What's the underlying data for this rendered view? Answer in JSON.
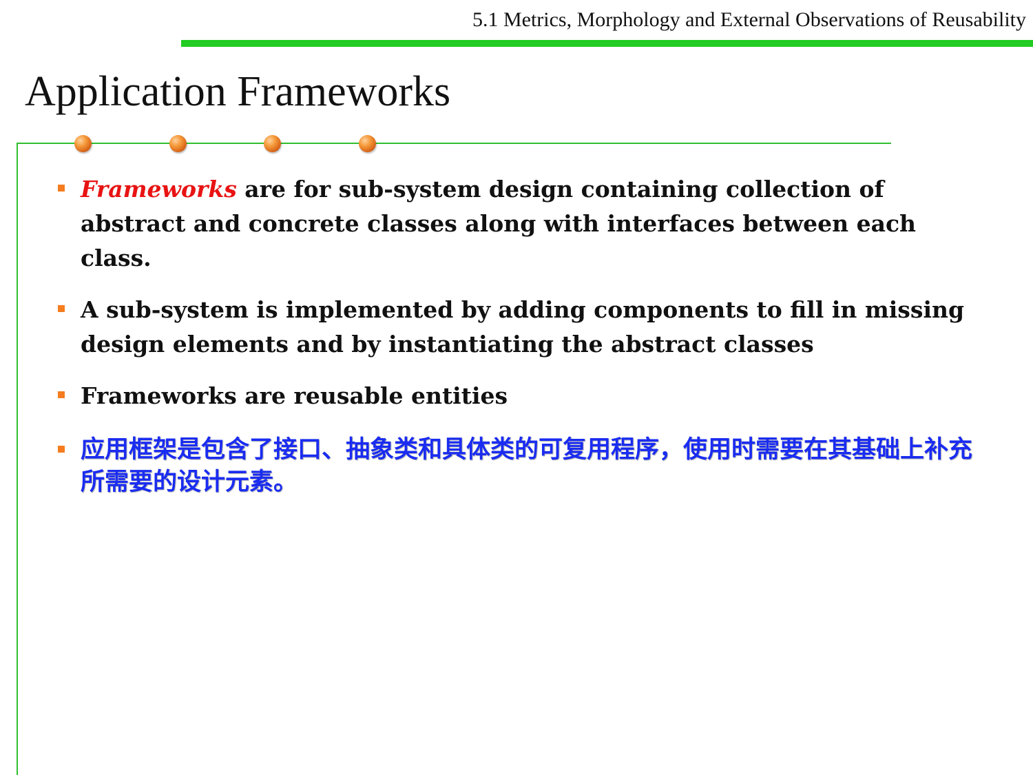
{
  "header": {
    "section_title": "5.1 Metrics, Morphology and External Observations of Reusability"
  },
  "slide": {
    "title": "Application Frameworks"
  },
  "bullets": {
    "b1_emphasis": "Frameworks",
    "b1_rest": " are for sub-system design containing collection of abstract and concrete classes along with interfaces between each class.",
    "b2": "A sub-system is implemented by adding components to fill in missing design elements and by instantiating the abstract classes",
    "b3": "Frameworks are reusable entities",
    "b4": "应用框架是包含了接口、抽象类和具体类的可复用程序，使用时需要在其基础上补充所需要的设计元素。"
  },
  "colors": {
    "header_rule": "#22cc22",
    "frame_line": "#2fbf2f",
    "bullet_marker": "#f57d1f",
    "emphasis_text": "#e81313",
    "cjk_text": "#1a2cf0",
    "decor_ball": "#f59a3a"
  }
}
